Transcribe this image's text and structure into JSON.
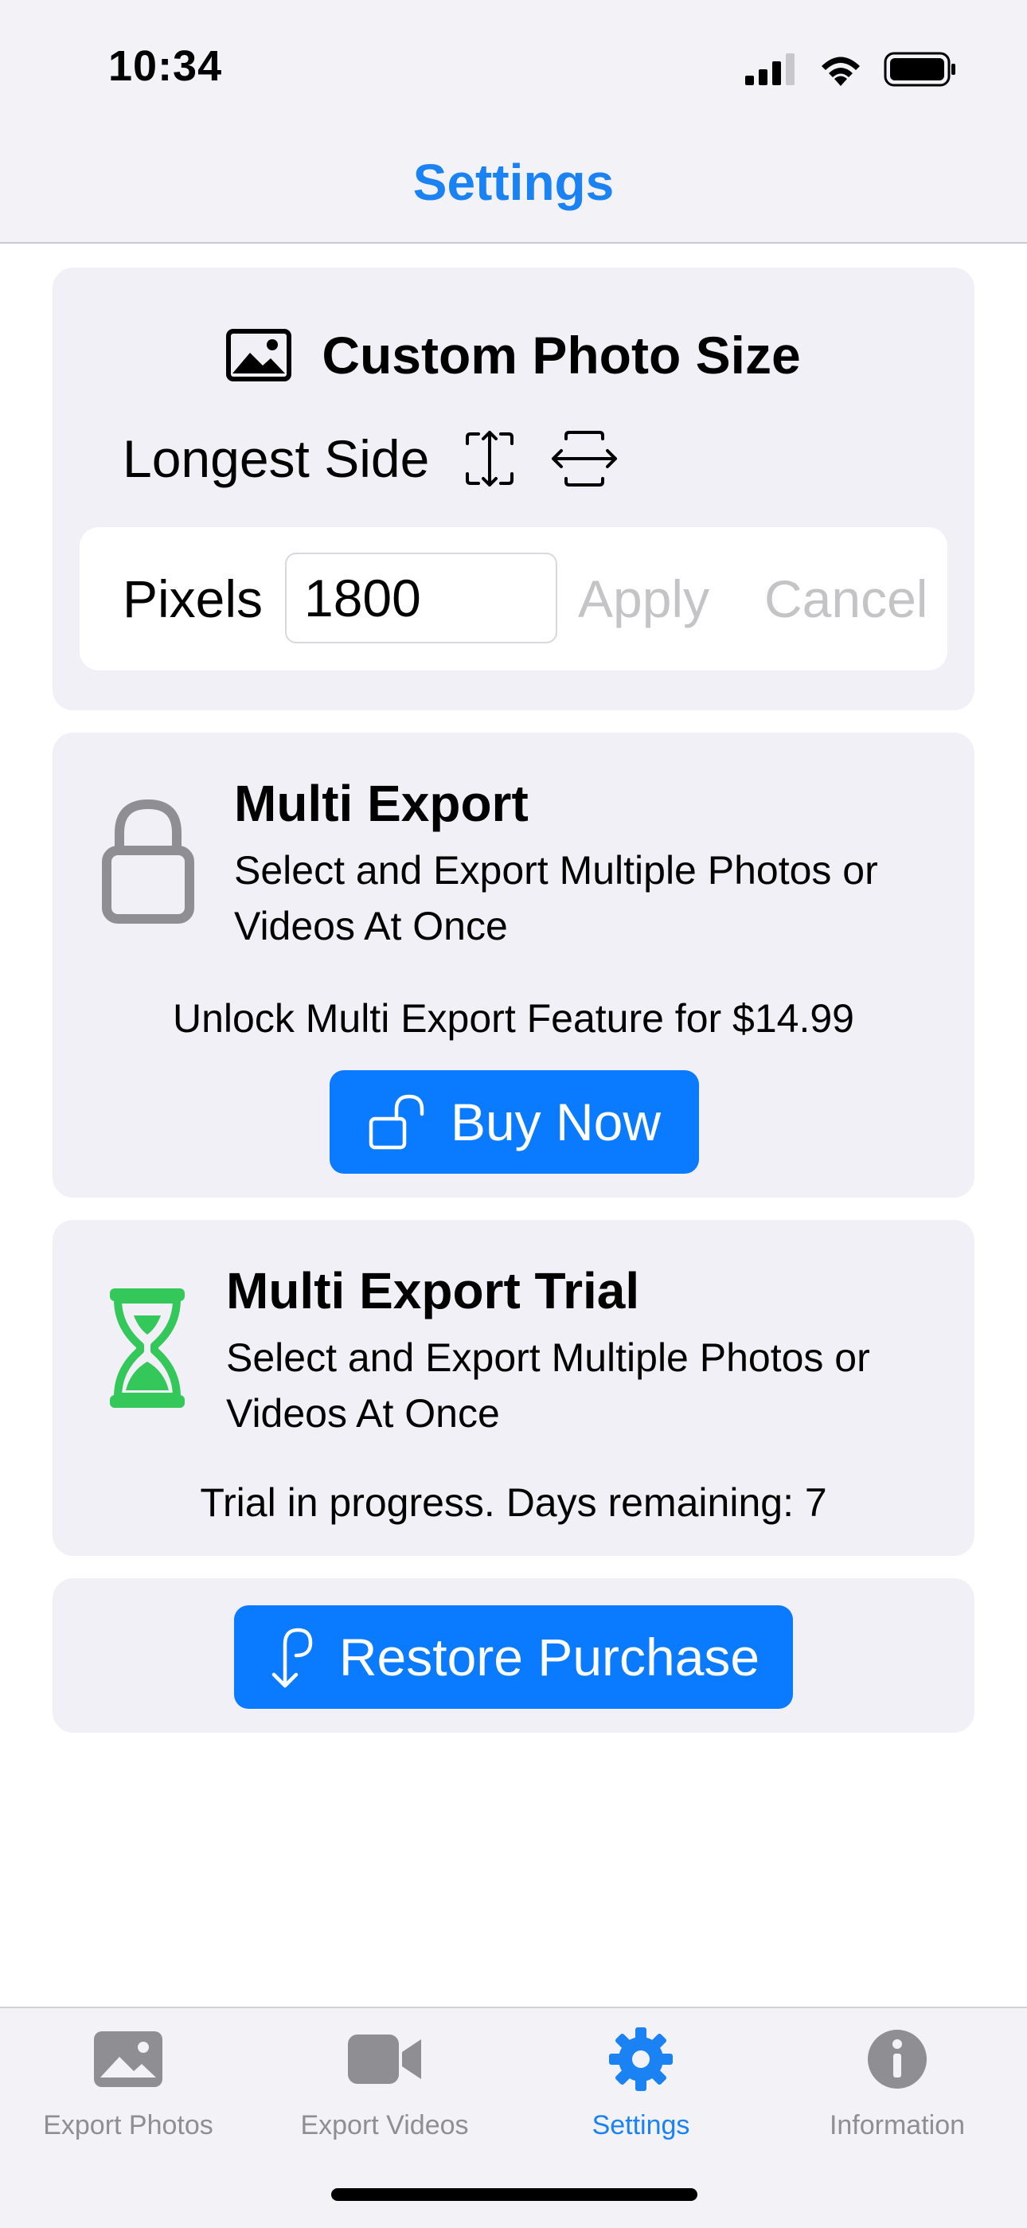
{
  "status_bar": {
    "time": "10:34",
    "icons": [
      "cellular-signal-icon",
      "wifi-icon",
      "battery-icon"
    ]
  },
  "nav": {
    "title": "Settings"
  },
  "custom_photo_size": {
    "icon": "photo-icon",
    "title": "Custom Photo Size",
    "mode_label": "Longest Side",
    "pixels_label": "Pixels",
    "pixels_value": "1800",
    "apply_label": "Apply",
    "cancel_label": "Cancel"
  },
  "multi_export": {
    "icon": "lock-icon",
    "title": "Multi Export",
    "description": "Select and Export Multiple Photos or Videos At Once",
    "unlock_text": "Unlock Multi Export Feature for $14.99",
    "buy_label": "Buy Now"
  },
  "trial": {
    "icon": "hourglass-icon",
    "title": "Multi Export Trial",
    "description": "Select and Export Multiple Photos or Videos At Once",
    "status": "Trial in progress. Days remaining: 7"
  },
  "restore": {
    "label": "Restore Purchase"
  },
  "tabs": [
    {
      "label": "Export Photos",
      "icon": "photo-icon",
      "active": false
    },
    {
      "label": "Export Videos",
      "icon": "video-camera-icon",
      "active": false
    },
    {
      "label": "Settings",
      "icon": "gear-icon",
      "active": true
    },
    {
      "label": "Information",
      "icon": "info-icon",
      "active": false
    }
  ],
  "colors": {
    "accent": "#1a82f2",
    "button": "#0a7aff",
    "trial_green": "#34c759",
    "disabled_text": "#c4c4c7",
    "card_bg": "#f0f0f6"
  }
}
